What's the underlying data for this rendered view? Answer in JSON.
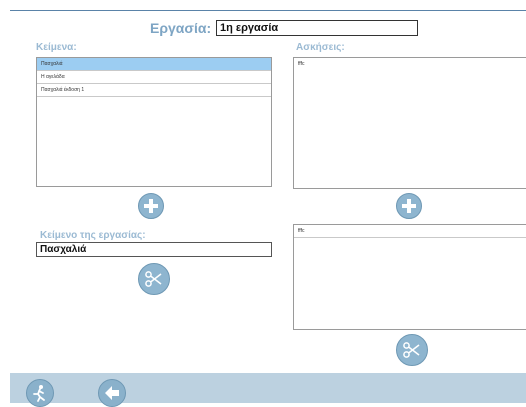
{
  "header": {
    "title_label": "Εργασία:",
    "title_value": "1η εργασία"
  },
  "texts_panel": {
    "label": "Κείμενα:",
    "items": [
      {
        "label": "Πασχαλιά",
        "selected": true
      },
      {
        "label": "Η αγελάδα",
        "selected": false
      },
      {
        "label": "Πασχαλιά έκδοση 1",
        "selected": false
      }
    ]
  },
  "exercises_panel": {
    "label": "Ασκήσεις:",
    "items": [
      {
        "label": "fffc"
      }
    ]
  },
  "assignment_text": {
    "label": "Κείμενο της εργασίας:",
    "value": "Πασχαλιά"
  },
  "assignment_exercises": {
    "items": [
      {
        "label": "fffc"
      }
    ]
  },
  "icons": {
    "add_text": "plus-icon",
    "add_exercise": "plus-icon",
    "remove_text": "scissors-icon",
    "remove_exercise": "scissors-icon",
    "exit": "running-man-icon",
    "back": "arrow-left-icon"
  },
  "colors": {
    "accent": "#8eb5cf",
    "label": "#9bbad3",
    "selected_row": "#9ccdf2",
    "bottom_bar": "#bcd1e0"
  }
}
